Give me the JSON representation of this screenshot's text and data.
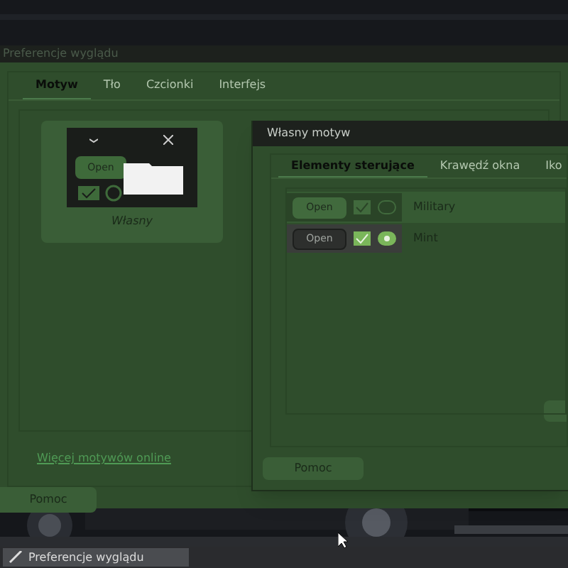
{
  "main_window": {
    "title": "Preferencje wyglądu",
    "tabs": [
      {
        "label": "Motyw",
        "selected": true
      },
      {
        "label": "Tło",
        "selected": false
      },
      {
        "label": "Czcionki",
        "selected": false
      },
      {
        "label": "Interfejs",
        "selected": false
      }
    ],
    "themes": [
      {
        "name": "Własny",
        "selected": true,
        "preview_button": "Open"
      }
    ],
    "link": "Więcej motywów online",
    "help_button": "Pomoc"
  },
  "dialog": {
    "title": "Własny motyw",
    "tabs": [
      {
        "label": "Elementy sterujące",
        "selected": true
      },
      {
        "label": "Krawędź okna",
        "selected": false
      },
      {
        "label": "Iko",
        "selected": false
      }
    ],
    "controls": [
      {
        "name": "Military",
        "button": "Open",
        "selected": true
      },
      {
        "name": "Mint",
        "button": "Open",
        "selected": false
      }
    ],
    "help_button": "Pomoc"
  },
  "taskbar": {
    "items": [
      {
        "label": "Preferencje wyglądu",
        "selected": true
      }
    ]
  }
}
